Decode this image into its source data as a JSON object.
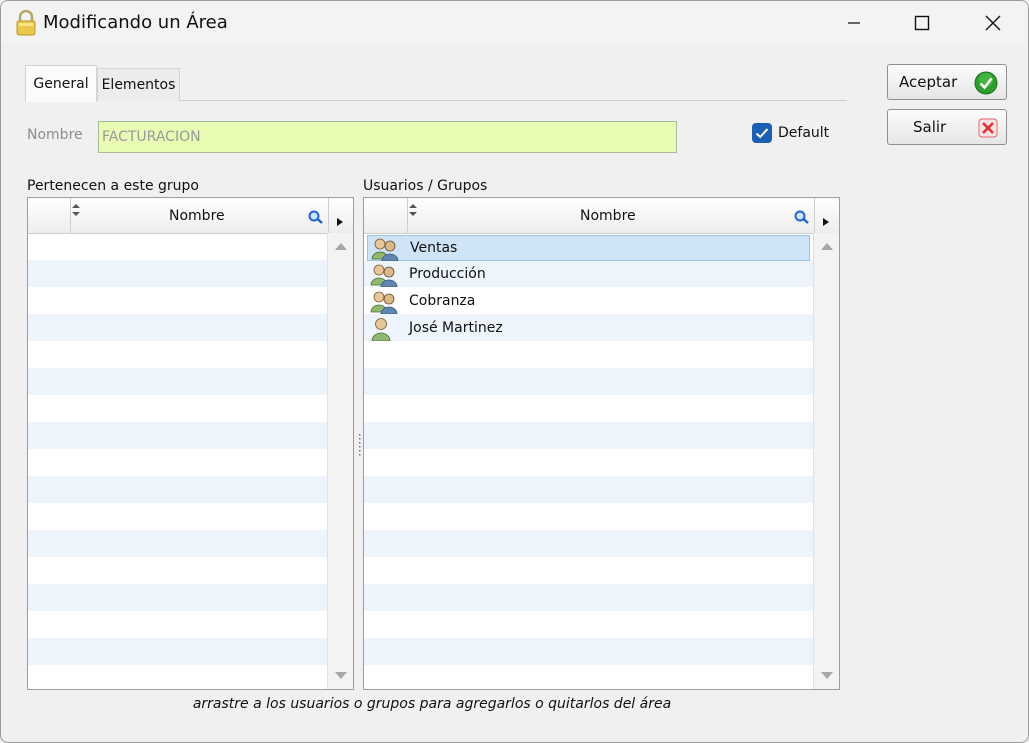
{
  "window": {
    "title": "Modificando un Área",
    "controls": {
      "minimize": "minimize-icon",
      "maximize": "maximize-icon",
      "close": "close-icon"
    }
  },
  "tabs": [
    {
      "label": "General",
      "active": true
    },
    {
      "label": "Elementos",
      "active": false
    }
  ],
  "form": {
    "nombre_label": "Nombre",
    "nombre_value": "FACTURACION",
    "default_label": "Default",
    "default_checked": true
  },
  "buttons": {
    "accept_label": "Aceptar",
    "exit_label": "Salir"
  },
  "left_panel": {
    "label": "Pertenecen a este grupo",
    "column": "Nombre",
    "items": []
  },
  "right_panel": {
    "label": "Usuarios / Grupos",
    "column": "Nombre",
    "items": [
      {
        "name": "Ventas",
        "type": "group",
        "selected": true
      },
      {
        "name": "Producción",
        "type": "group",
        "selected": false
      },
      {
        "name": "Cobranza",
        "type": "group",
        "selected": false
      },
      {
        "name": "José Martinez",
        "type": "user",
        "selected": false
      }
    ]
  },
  "hint": "arrastre a los usuarios o grupos para agregarlos  o quitarlos del área",
  "colors": {
    "accent": "#1a5fb4",
    "input_bg": "#e8fcb3",
    "row_alt": "#edf4fb",
    "selected_row": "#cfe4f7"
  }
}
